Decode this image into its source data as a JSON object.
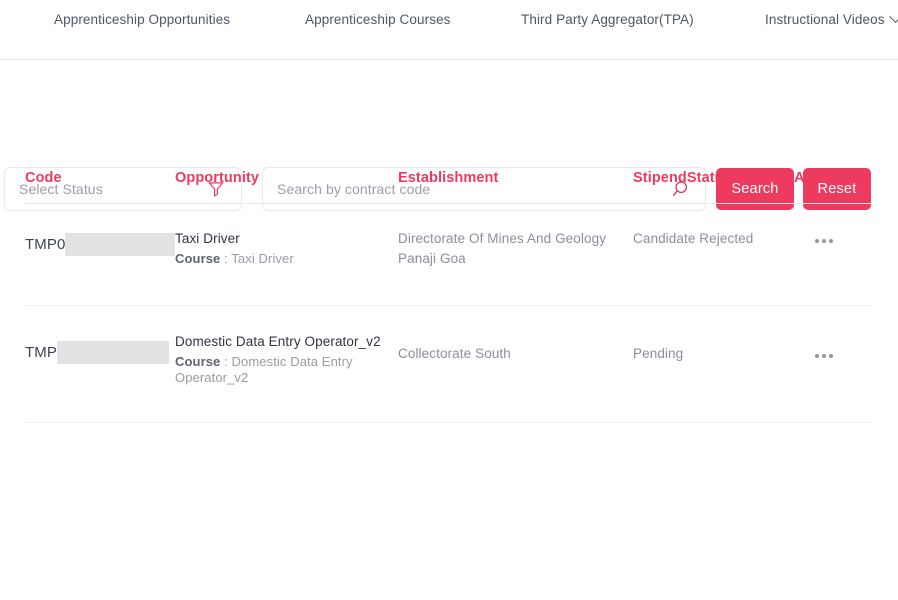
{
  "nav": {
    "items": [
      {
        "label": "Apprenticeship Opportunities",
        "has_chevron": false
      },
      {
        "label": "Apprenticeship Courses",
        "has_chevron": false
      },
      {
        "label": "Third Party Aggregator(TPA)",
        "has_chevron": false
      },
      {
        "label": "Instructional Videos",
        "has_chevron": true
      }
    ]
  },
  "filters": {
    "status_placeholder": "Select Status",
    "status_icon": "filter-funnel-icon",
    "search_placeholder": "Search by contract code",
    "search_value": "",
    "search_icon": "search-icon",
    "search_button": "Search",
    "reset_button": "Reset"
  },
  "table": {
    "headers": {
      "code": "Code",
      "opportunity": "Opportunity",
      "establishment": "Establishment",
      "stipend_status": "StipendStatus",
      "actions": "Actions"
    },
    "rows": [
      {
        "code_prefix": "TMP0",
        "code_redacted": true,
        "opportunity_title": "Taxi Driver",
        "course_label": "Course",
        "course_separator": " : ",
        "course_name": "Taxi Driver",
        "establishment": "Directorate Of Mines And Geology Panaji Goa",
        "stipend_status": "Candidate Rejected",
        "actions_icon": "ellipsis-icon"
      },
      {
        "code_prefix": "TMP",
        "code_redacted": true,
        "opportunity_title": "Domestic Data Entry Operator_v2",
        "course_label": "Course",
        "course_separator": " : ",
        "course_name": "Domestic Data Entry Operator_v2",
        "establishment": "Collectorate South",
        "stipend_status": "Pending",
        "actions_icon": "ellipsis-icon"
      }
    ]
  },
  "colors": {
    "accent": "#ee3a5e",
    "nav_text": "#4e5767",
    "body_text": "#8e8e99",
    "border": "#e9e9ee"
  }
}
